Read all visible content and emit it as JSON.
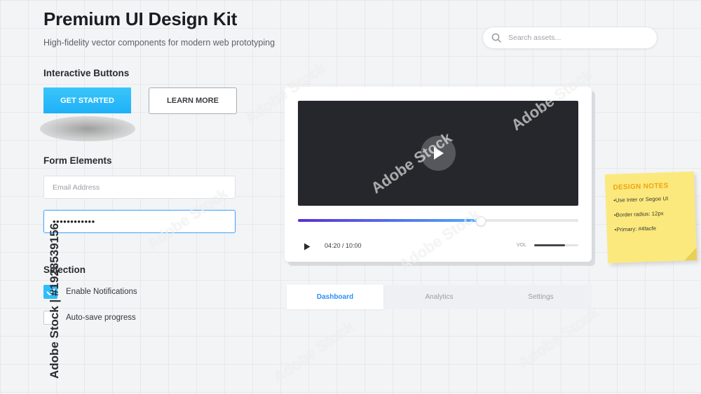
{
  "header": {
    "title": "Premium UI Design Kit",
    "subtitle": "High-fidelity vector components for modern web prototyping"
  },
  "search": {
    "placeholder": "Search assets...",
    "icon": "search-icon"
  },
  "buttons_section": {
    "heading": "Interactive Buttons",
    "primary_label": "GET STARTED",
    "secondary_label": "LEARN MORE"
  },
  "form_section": {
    "heading": "Form Elements",
    "email_placeholder": "Email Address",
    "password_value": "••••••••••••"
  },
  "selection_section": {
    "heading": "Selection",
    "items": [
      {
        "label": "Enable Notifications",
        "checked": true
      },
      {
        "label": "Auto-save progress",
        "checked": false
      }
    ]
  },
  "player": {
    "time": "04:20 / 10:00",
    "progress": 0.65,
    "volume_label": "VOL",
    "volume": 0.7
  },
  "tabs": [
    {
      "label": "Dashboard",
      "active": true
    },
    {
      "label": "Analytics",
      "active": false
    },
    {
      "label": "Settings",
      "active": false
    }
  ],
  "notes": {
    "title": "DESIGN NOTES",
    "items": [
      "Use Inter or Segoe UI",
      "Border radius: 12px",
      "Primary: #4facfe"
    ]
  },
  "watermark": {
    "brand": "Adobe Stock",
    "stock_id": "Adobe Stock | #1928539156"
  },
  "colors": {
    "primary": "#4facfe",
    "accent_gradient_start": "#5a2fd6",
    "note_yellow": "#fbe97e",
    "note_title": "#f0a30a"
  }
}
